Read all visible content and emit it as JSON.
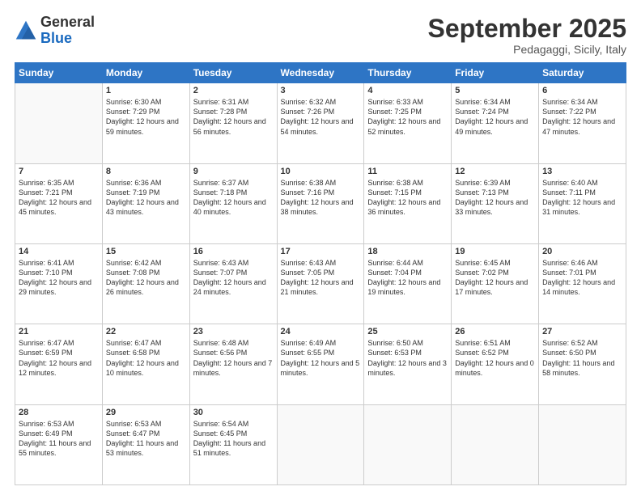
{
  "header": {
    "logo_general": "General",
    "logo_blue": "Blue",
    "month": "September 2025",
    "location": "Pedagaggi, Sicily, Italy"
  },
  "weekdays": [
    "Sunday",
    "Monday",
    "Tuesday",
    "Wednesday",
    "Thursday",
    "Friday",
    "Saturday"
  ],
  "weeks": [
    [
      {
        "day": "",
        "sunrise": "",
        "sunset": "",
        "daylight": ""
      },
      {
        "day": "1",
        "sunrise": "Sunrise: 6:30 AM",
        "sunset": "Sunset: 7:29 PM",
        "daylight": "Daylight: 12 hours and 59 minutes."
      },
      {
        "day": "2",
        "sunrise": "Sunrise: 6:31 AM",
        "sunset": "Sunset: 7:28 PM",
        "daylight": "Daylight: 12 hours and 56 minutes."
      },
      {
        "day": "3",
        "sunrise": "Sunrise: 6:32 AM",
        "sunset": "Sunset: 7:26 PM",
        "daylight": "Daylight: 12 hours and 54 minutes."
      },
      {
        "day": "4",
        "sunrise": "Sunrise: 6:33 AM",
        "sunset": "Sunset: 7:25 PM",
        "daylight": "Daylight: 12 hours and 52 minutes."
      },
      {
        "day": "5",
        "sunrise": "Sunrise: 6:34 AM",
        "sunset": "Sunset: 7:24 PM",
        "daylight": "Daylight: 12 hours and 49 minutes."
      },
      {
        "day": "6",
        "sunrise": "Sunrise: 6:34 AM",
        "sunset": "Sunset: 7:22 PM",
        "daylight": "Daylight: 12 hours and 47 minutes."
      }
    ],
    [
      {
        "day": "7",
        "sunrise": "Sunrise: 6:35 AM",
        "sunset": "Sunset: 7:21 PM",
        "daylight": "Daylight: 12 hours and 45 minutes."
      },
      {
        "day": "8",
        "sunrise": "Sunrise: 6:36 AM",
        "sunset": "Sunset: 7:19 PM",
        "daylight": "Daylight: 12 hours and 43 minutes."
      },
      {
        "day": "9",
        "sunrise": "Sunrise: 6:37 AM",
        "sunset": "Sunset: 7:18 PM",
        "daylight": "Daylight: 12 hours and 40 minutes."
      },
      {
        "day": "10",
        "sunrise": "Sunrise: 6:38 AM",
        "sunset": "Sunset: 7:16 PM",
        "daylight": "Daylight: 12 hours and 38 minutes."
      },
      {
        "day": "11",
        "sunrise": "Sunrise: 6:38 AM",
        "sunset": "Sunset: 7:15 PM",
        "daylight": "Daylight: 12 hours and 36 minutes."
      },
      {
        "day": "12",
        "sunrise": "Sunrise: 6:39 AM",
        "sunset": "Sunset: 7:13 PM",
        "daylight": "Daylight: 12 hours and 33 minutes."
      },
      {
        "day": "13",
        "sunrise": "Sunrise: 6:40 AM",
        "sunset": "Sunset: 7:11 PM",
        "daylight": "Daylight: 12 hours and 31 minutes."
      }
    ],
    [
      {
        "day": "14",
        "sunrise": "Sunrise: 6:41 AM",
        "sunset": "Sunset: 7:10 PM",
        "daylight": "Daylight: 12 hours and 29 minutes."
      },
      {
        "day": "15",
        "sunrise": "Sunrise: 6:42 AM",
        "sunset": "Sunset: 7:08 PM",
        "daylight": "Daylight: 12 hours and 26 minutes."
      },
      {
        "day": "16",
        "sunrise": "Sunrise: 6:43 AM",
        "sunset": "Sunset: 7:07 PM",
        "daylight": "Daylight: 12 hours and 24 minutes."
      },
      {
        "day": "17",
        "sunrise": "Sunrise: 6:43 AM",
        "sunset": "Sunset: 7:05 PM",
        "daylight": "Daylight: 12 hours and 21 minutes."
      },
      {
        "day": "18",
        "sunrise": "Sunrise: 6:44 AM",
        "sunset": "Sunset: 7:04 PM",
        "daylight": "Daylight: 12 hours and 19 minutes."
      },
      {
        "day": "19",
        "sunrise": "Sunrise: 6:45 AM",
        "sunset": "Sunset: 7:02 PM",
        "daylight": "Daylight: 12 hours and 17 minutes."
      },
      {
        "day": "20",
        "sunrise": "Sunrise: 6:46 AM",
        "sunset": "Sunset: 7:01 PM",
        "daylight": "Daylight: 12 hours and 14 minutes."
      }
    ],
    [
      {
        "day": "21",
        "sunrise": "Sunrise: 6:47 AM",
        "sunset": "Sunset: 6:59 PM",
        "daylight": "Daylight: 12 hours and 12 minutes."
      },
      {
        "day": "22",
        "sunrise": "Sunrise: 6:47 AM",
        "sunset": "Sunset: 6:58 PM",
        "daylight": "Daylight: 12 hours and 10 minutes."
      },
      {
        "day": "23",
        "sunrise": "Sunrise: 6:48 AM",
        "sunset": "Sunset: 6:56 PM",
        "daylight": "Daylight: 12 hours and 7 minutes."
      },
      {
        "day": "24",
        "sunrise": "Sunrise: 6:49 AM",
        "sunset": "Sunset: 6:55 PM",
        "daylight": "Daylight: 12 hours and 5 minutes."
      },
      {
        "day": "25",
        "sunrise": "Sunrise: 6:50 AM",
        "sunset": "Sunset: 6:53 PM",
        "daylight": "Daylight: 12 hours and 3 minutes."
      },
      {
        "day": "26",
        "sunrise": "Sunrise: 6:51 AM",
        "sunset": "Sunset: 6:52 PM",
        "daylight": "Daylight: 12 hours and 0 minutes."
      },
      {
        "day": "27",
        "sunrise": "Sunrise: 6:52 AM",
        "sunset": "Sunset: 6:50 PM",
        "daylight": "Daylight: 11 hours and 58 minutes."
      }
    ],
    [
      {
        "day": "28",
        "sunrise": "Sunrise: 6:53 AM",
        "sunset": "Sunset: 6:49 PM",
        "daylight": "Daylight: 11 hours and 55 minutes."
      },
      {
        "day": "29",
        "sunrise": "Sunrise: 6:53 AM",
        "sunset": "Sunset: 6:47 PM",
        "daylight": "Daylight: 11 hours and 53 minutes."
      },
      {
        "day": "30",
        "sunrise": "Sunrise: 6:54 AM",
        "sunset": "Sunset: 6:45 PM",
        "daylight": "Daylight: 11 hours and 51 minutes."
      },
      {
        "day": "",
        "sunrise": "",
        "sunset": "",
        "daylight": ""
      },
      {
        "day": "",
        "sunrise": "",
        "sunset": "",
        "daylight": ""
      },
      {
        "day": "",
        "sunrise": "",
        "sunset": "",
        "daylight": ""
      },
      {
        "day": "",
        "sunrise": "",
        "sunset": "",
        "daylight": ""
      }
    ]
  ]
}
